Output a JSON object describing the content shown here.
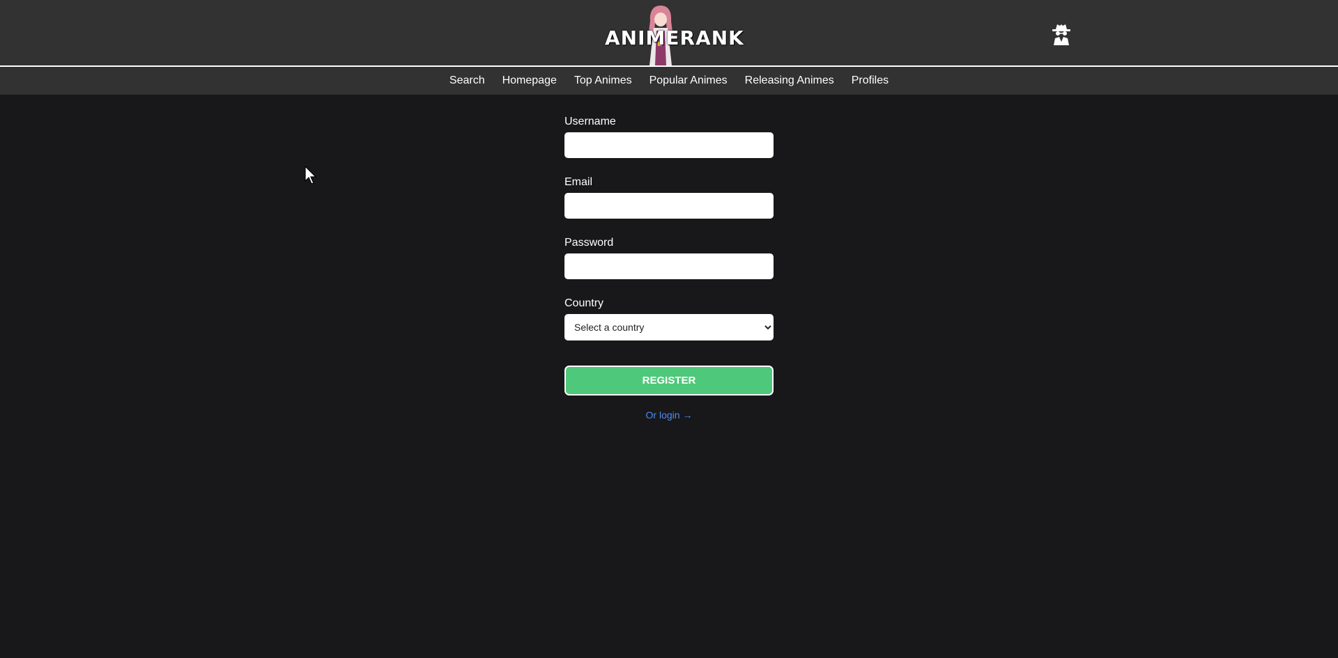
{
  "header": {
    "logo_text": "ANIMERANK",
    "user_icon": "incognito-user-icon"
  },
  "nav": {
    "items": [
      {
        "label": "Search"
      },
      {
        "label": "Homepage"
      },
      {
        "label": "Top Animes"
      },
      {
        "label": "Popular Animes"
      },
      {
        "label": "Releasing Animes"
      },
      {
        "label": "Profiles"
      }
    ]
  },
  "form": {
    "username": {
      "label": "Username",
      "value": ""
    },
    "email": {
      "label": "Email",
      "value": ""
    },
    "password": {
      "label": "Password",
      "value": ""
    },
    "country": {
      "label": "Country",
      "selected": "Select a country"
    },
    "register_label": "REGISTER",
    "login_link": "Or login →"
  },
  "colors": {
    "background": "#18181a",
    "header": "#323232",
    "register_button": "#4ec87a",
    "link": "#4c8cf5"
  }
}
